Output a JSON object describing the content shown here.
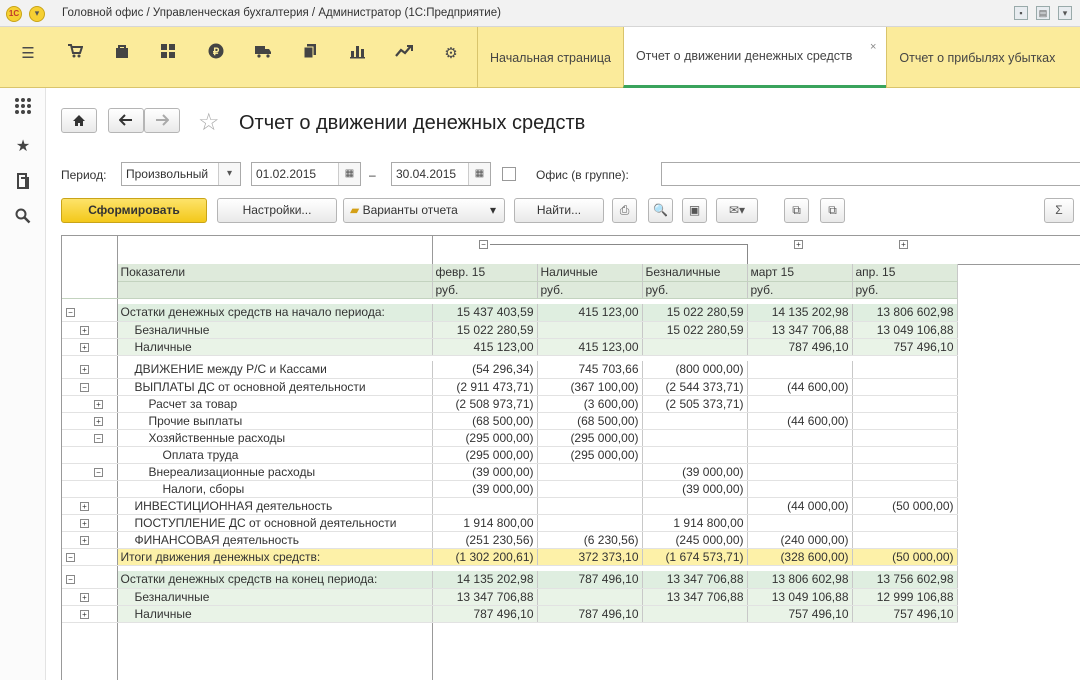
{
  "window": {
    "title": "Головной офис / Управленческая бухгалтерия / Администратор  (1С:Предприятие)",
    "logo": "1C"
  },
  "sections": {
    "icons": [
      "menu-icon",
      "cart-icon",
      "bag-icon",
      "grid-icon",
      "ruble-icon",
      "truck-icon",
      "documents-icon",
      "bar-chart-icon",
      "trend-icon",
      "gear-icon"
    ],
    "tabs": [
      {
        "label": "Начальная страница"
      },
      {
        "label": "Отчет о движении денежных средств"
      },
      {
        "label": "Отчет о прибылях убытках"
      }
    ]
  },
  "leftbar": {
    "icons": [
      "apps-icon",
      "star-icon",
      "history-icon",
      "search-icon"
    ]
  },
  "page": {
    "title": "Отчет о движении денежных средств",
    "period_label": "Период:",
    "period_value": "Произвольный",
    "date_from": "01.02.2015",
    "dash": "–",
    "date_to": "30.04.2015",
    "office_label": "Офис (в группе):",
    "office_value": ""
  },
  "toolbar": {
    "generate": "Сформировать",
    "settings": "Настройки...",
    "variants": "Варианты отчета",
    "find": "Найти...",
    "sum": "Σ"
  },
  "report": {
    "header": {
      "indicator": "Показатели",
      "columns": [
        {
          "period": "февр. 15",
          "unit": "руб."
        },
        {
          "period": "Наличные",
          "unit": "руб."
        },
        {
          "period": "Безналичные",
          "unit": "руб."
        },
        {
          "period": "март 15",
          "unit": "руб."
        },
        {
          "period": "апр. 15",
          "unit": "руб."
        }
      ]
    },
    "rows": [
      {
        "label": "Остатки денежных средств на начало периода:",
        "level": 0,
        "values": [
          "15 437 403,59",
          "415 123,00",
          "15 022 280,59",
          "14 135 202,98",
          "13 806 602,98"
        ]
      },
      {
        "label": "Безналичные",
        "level": 1,
        "values": [
          "15 022 280,59",
          "",
          "15 022 280,59",
          "13 347 706,88",
          "13 049 106,88"
        ]
      },
      {
        "label": "Наличные",
        "level": 1,
        "values": [
          "415 123,00",
          "415 123,00",
          "",
          "787 496,10",
          "757 496,10"
        ]
      },
      {
        "label": "ДВИЖЕНИЕ между Р/С и Кассами",
        "level": 1,
        "values": [
          "(54 296,34)",
          "745 703,66",
          "(800 000,00)",
          "",
          ""
        ]
      },
      {
        "label": "ВЫПЛАТЫ ДС от основной деятельности",
        "level": 1,
        "values": [
          "(2 911 473,71)",
          "(367 100,00)",
          "(2 544 373,71)",
          "(44 600,00)",
          ""
        ]
      },
      {
        "label": "Расчет за товар",
        "level": 2,
        "values": [
          "(2 508 973,71)",
          "(3 600,00)",
          "(2 505 373,71)",
          "",
          ""
        ]
      },
      {
        "label": "Прочие выплаты",
        "level": 2,
        "values": [
          "(68 500,00)",
          "(68 500,00)",
          "",
          "(44 600,00)",
          ""
        ]
      },
      {
        "label": "Хозяйственные расходы",
        "level": 2,
        "values": [
          "(295 000,00)",
          "(295 000,00)",
          "",
          "",
          ""
        ]
      },
      {
        "label": "Оплата труда",
        "level": 3,
        "values": [
          "(295 000,00)",
          "(295 000,00)",
          "",
          "",
          ""
        ]
      },
      {
        "label": "Внереализационные расходы",
        "level": 2,
        "values": [
          "(39 000,00)",
          "",
          "(39 000,00)",
          "",
          ""
        ]
      },
      {
        "label": "Налоги, сборы",
        "level": 3,
        "values": [
          "(39 000,00)",
          "",
          "(39 000,00)",
          "",
          ""
        ]
      },
      {
        "label": "ИНВЕСТИЦИОННАЯ деятельность",
        "level": 1,
        "values": [
          "",
          "",
          "",
          "(44 000,00)",
          "(50 000,00)"
        ]
      },
      {
        "label": "ПОСТУПЛЕНИЕ ДС от основной деятельности",
        "level": 1,
        "values": [
          "1 914 800,00",
          "",
          "1 914 800,00",
          "",
          ""
        ]
      },
      {
        "label": "ФИНАНСОВАЯ деятельность",
        "level": 1,
        "values": [
          "(251 230,56)",
          "(6 230,56)",
          "(245 000,00)",
          "(240 000,00)",
          ""
        ]
      },
      {
        "label": "Итоги движения денежных средств:",
        "level": 0,
        "values": [
          "(1 302 200,61)",
          "372 373,10",
          "(1 674 573,71)",
          "(328 600,00)",
          "(50 000,00)"
        ]
      },
      {
        "label": "Остатки денежных средств на конец периода:",
        "level": 0,
        "values": [
          "14 135 202,98",
          "787 496,10",
          "13 347 706,88",
          "13 806 602,98",
          "13 756 602,98"
        ]
      },
      {
        "label": "Безналичные",
        "level": 1,
        "values": [
          "13 347 706,88",
          "",
          "13 347 706,88",
          "13 049 106,88",
          "12 999 106,88"
        ]
      },
      {
        "label": "Наличные",
        "level": 1,
        "values": [
          "787 496,10",
          "787 496,10",
          "",
          "757 496,10",
          "757 496,10"
        ]
      }
    ]
  }
}
